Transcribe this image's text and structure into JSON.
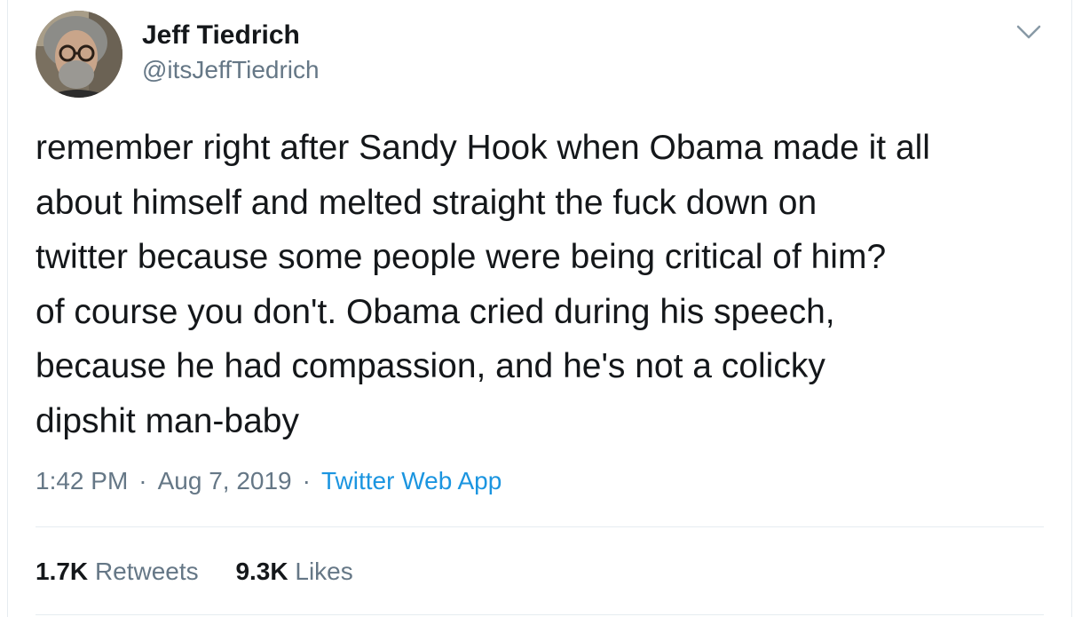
{
  "author": {
    "display_name": "Jeff Tiedrich",
    "handle": "@itsJeffTiedrich",
    "avatar_icon": "profile-photo"
  },
  "tweet": {
    "text": "remember right after Sandy Hook when Obama made it all\nabout himself and melted straight the fuck down on\ntwitter because some people were being critical of him?\nof course you don't. Obama cried during his speech,\nbecause he had compassion, and he's not a colicky\ndipshit man-baby",
    "time": "1:42 PM",
    "separator": "·",
    "date": "Aug 7, 2019",
    "source": "Twitter Web App"
  },
  "stats": {
    "retweets_count": "1.7K",
    "retweets_label": "Retweets",
    "likes_count": "9.3K",
    "likes_label": "Likes"
  },
  "menu_icon": "chevron-down-icon",
  "colors": {
    "text": "#14171a",
    "secondary": "#657786",
    "link": "#1b95e0",
    "border": "#e6ecf0"
  }
}
